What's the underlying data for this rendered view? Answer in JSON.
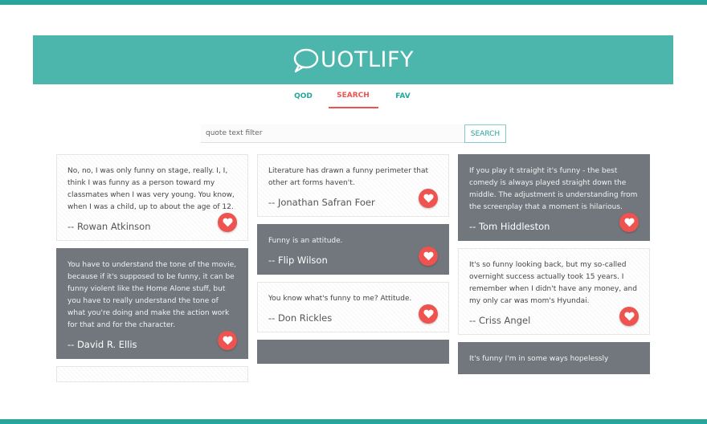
{
  "app": {
    "name": "QUOTLIFY",
    "name_rest": "UOTLIFY"
  },
  "nav": {
    "tabs": [
      {
        "label": "QOD"
      },
      {
        "label": "SEARCH"
      },
      {
        "label": "FAV"
      }
    ],
    "active": "SEARCH"
  },
  "search": {
    "placeholder": "quote text filter",
    "value": "",
    "button_label": "SEARCH"
  },
  "colors": {
    "header": "#4db6ac",
    "accent": "#ef5350",
    "frame": "#26a69a",
    "dark_card": "#72777d"
  },
  "quotes": {
    "col1": [
      {
        "text": "No, no, I was only funny on stage, really. I, I, think I was funny as a person toward my classmates when I was very young. You know, when I was a child, up to about the age of 12.",
        "author": "-- Rowan Atkinson"
      },
      {
        "text": "You have to understand the tone of the movie, because if it's supposed to be funny, it can be funny violent like the Home Alone stuff, but you have to really understand the tone of what you're doing and make the action work for that and for the character.",
        "author": "-- David R. Ellis"
      }
    ],
    "col2": [
      {
        "text": "Literature has drawn a funny perimeter that other art forms haven't.",
        "author": "-- Jonathan Safran Foer"
      },
      {
        "text": "Funny is an attitude.",
        "author": "-- Flip Wilson"
      },
      {
        "text": "You know what's funny to me? Attitude.",
        "author": "-- Don Rickles"
      }
    ],
    "col3": [
      {
        "text": "If you play it straight it's funny - the best comedy is always played straight down the middle. The adjustment is understanding from the screenplay that a moment is hilarious.",
        "author": "-- Tom Hiddleston"
      },
      {
        "text": "It's so funny looking back, but my so-called overnight success actually took 15 years. I remember when I didn't have any money, and my only car was mom's Hyundai.",
        "author": "-- Criss Angel"
      },
      {
        "text": "It's funny I'm in some ways hopelessly"
      }
    ]
  }
}
